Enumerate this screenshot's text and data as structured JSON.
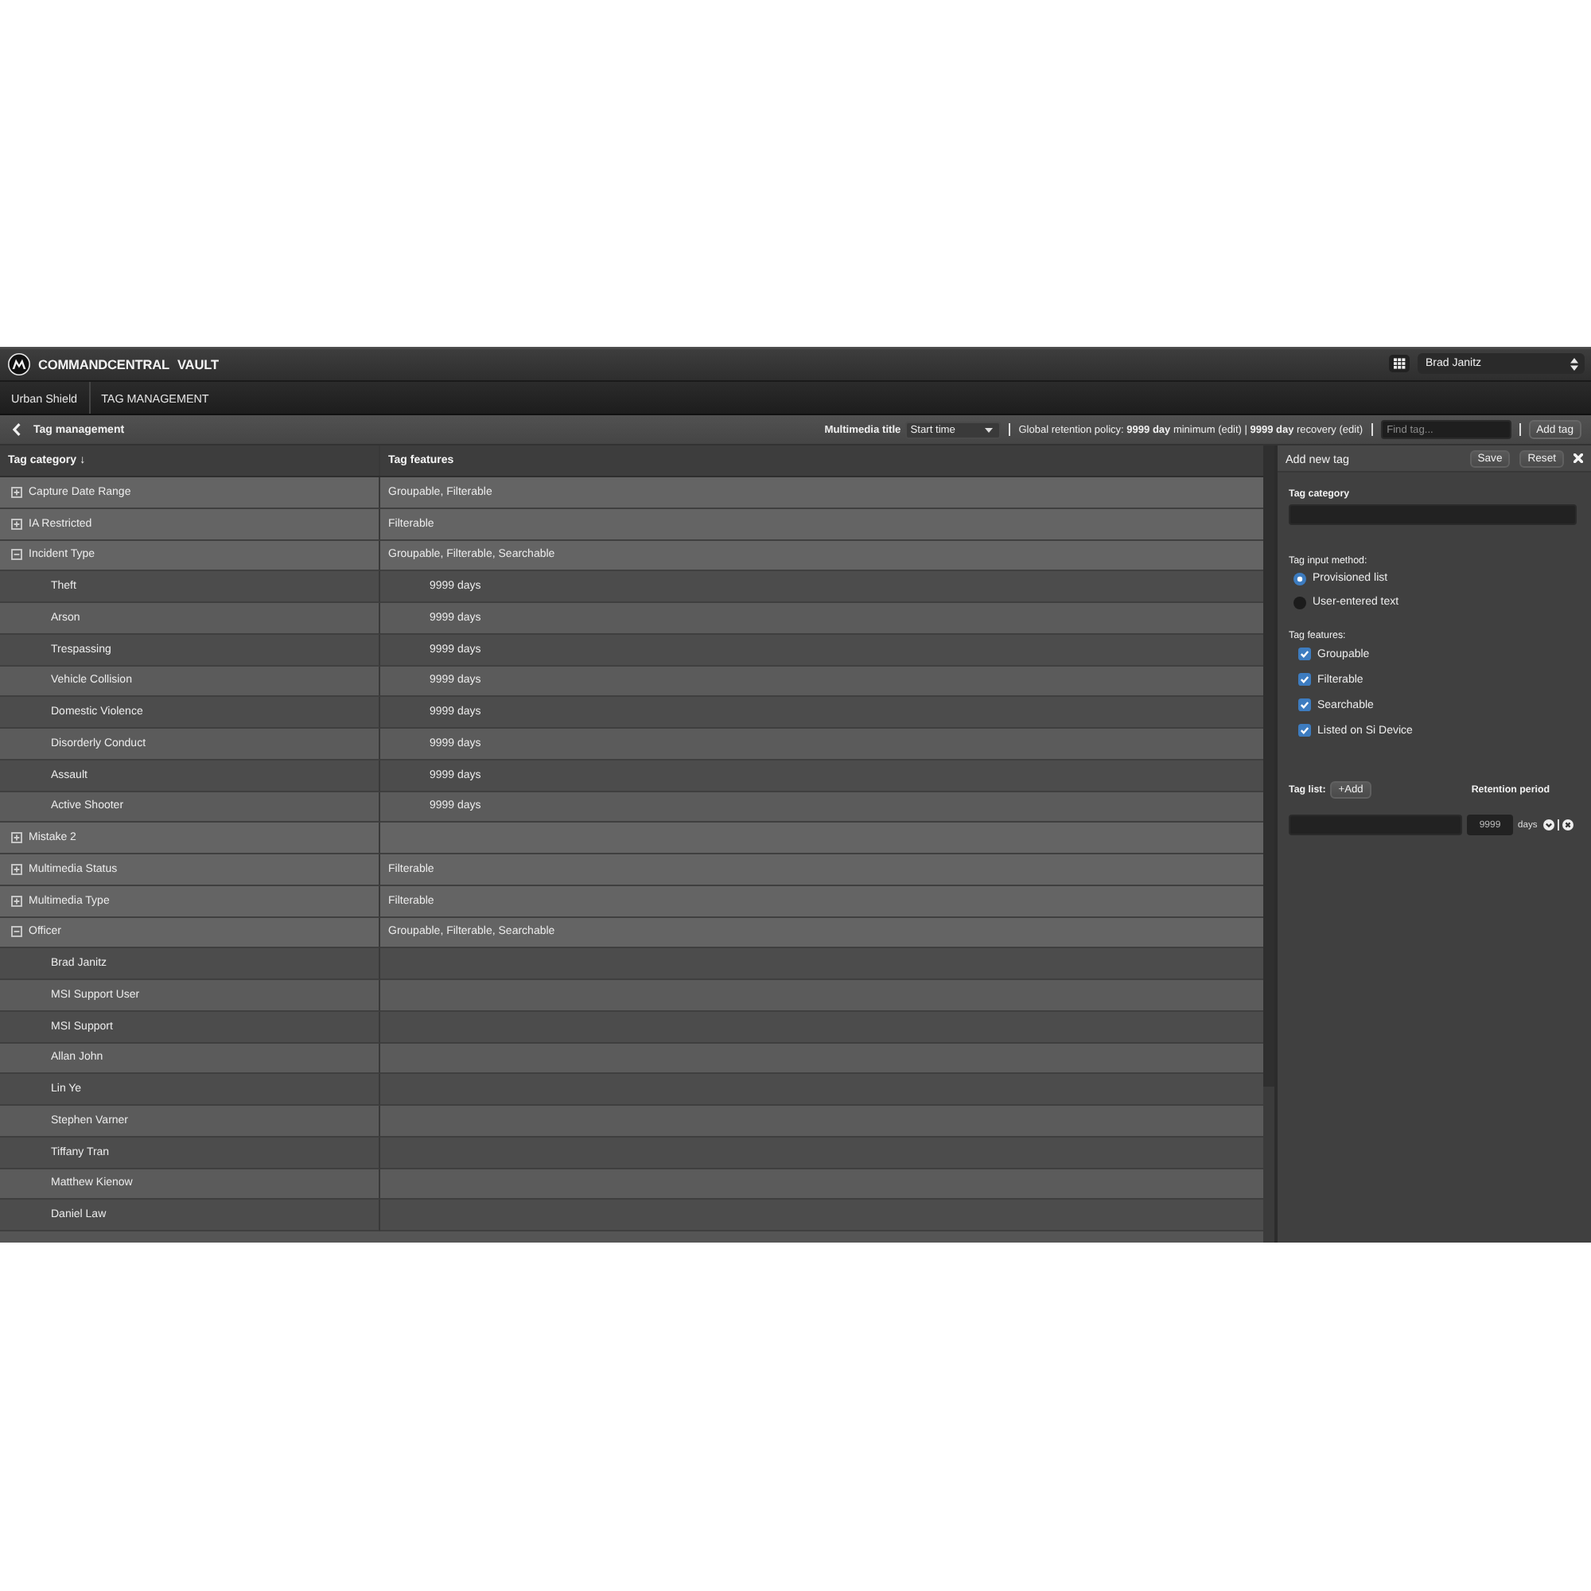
{
  "header": {
    "brand": [
      "COMMANDCENTRAL",
      "VAULT"
    ],
    "user_select": {
      "value": "Brad Janitz"
    }
  },
  "nav": {
    "items": [
      "Urban Shield",
      "TAG MANAGEMENT"
    ]
  },
  "toolbar": {
    "title": "Tag management",
    "multimedia_title": {
      "label": "Multimedia title",
      "value": "Start time"
    },
    "retention_policy": "Global retention policy: **9999 day** minimum (edit) | **9999 day** recovery (edit)",
    "search": {
      "placeholder": "Find tag..."
    },
    "add_button": "Add tag"
  },
  "table": {
    "columns": [
      {
        "label": "Tag category",
        "sort_icon": "↓"
      },
      {
        "label": "Tag features"
      }
    ],
    "rows": [
      {
        "category": "Capture Date Range",
        "features": "Groupable, Filterable",
        "expanded": false
      },
      {
        "category": "IA Restricted",
        "features": "Filterable",
        "expanded": false
      },
      {
        "category": "Incident Type",
        "features": "Groupable, Filterable, Searchable",
        "expanded": true,
        "children": [
          {
            "name": "Theft",
            "retention": "9999 days"
          },
          {
            "name": "Arson",
            "retention": "9999 days"
          },
          {
            "name": "Trespassing",
            "retention": "9999 days"
          },
          {
            "name": "Vehicle Collision",
            "retention": "9999 days"
          },
          {
            "name": "Domestic Violence",
            "retention": "9999 days"
          },
          {
            "name": "Disorderly Conduct",
            "retention": "9999 days"
          },
          {
            "name": "Assault",
            "retention": "9999 days"
          },
          {
            "name": "Active Shooter",
            "retention": "9999 days"
          }
        ]
      },
      {
        "category": "Mistake 2",
        "expanded": false
      },
      {
        "category": "Multimedia Status",
        "features": "Filterable",
        "expanded": false
      },
      {
        "category": "Multimedia Type",
        "features": "Filterable",
        "expanded": false
      },
      {
        "category": "Officer",
        "features": "Groupable, Filterable, Searchable",
        "expanded": true,
        "children": [
          {
            "name": "Brad Janitz"
          },
          {
            "name": "MSI Support User"
          },
          {
            "name": "MSI Support"
          },
          {
            "name": "Allan John"
          },
          {
            "name": "Lin Ye"
          },
          {
            "name": "Stephen Varner"
          },
          {
            "name": "Tiffany Tran"
          },
          {
            "name": "Matthew Kienow"
          },
          {
            "name": "Daniel Law"
          }
        ]
      }
    ]
  },
  "panel": {
    "title": "Add new tag",
    "buttons": [
      "Save",
      "Reset"
    ],
    "category": {
      "label": "Tag category"
    },
    "input_method": {
      "label": "Tag input method:",
      "options": [
        {
          "label": "Provisioned list",
          "selected": true
        },
        {
          "label": "User-entered text",
          "selected": false
        }
      ]
    },
    "features": {
      "label": "Tag features:",
      "options": [
        {
          "label": "Groupable",
          "checked": true
        },
        {
          "label": "Filterable",
          "checked": true
        },
        {
          "label": "Searchable",
          "checked": true
        },
        {
          "label": "Listed on Si Device",
          "checked": true
        }
      ]
    },
    "tag_list": {
      "label": "Tag list:",
      "add_button": "+Add",
      "retention_label": "Retention period",
      "entries": [
        {
          "retention": "9999",
          "unit": "days"
        }
      ]
    }
  }
}
